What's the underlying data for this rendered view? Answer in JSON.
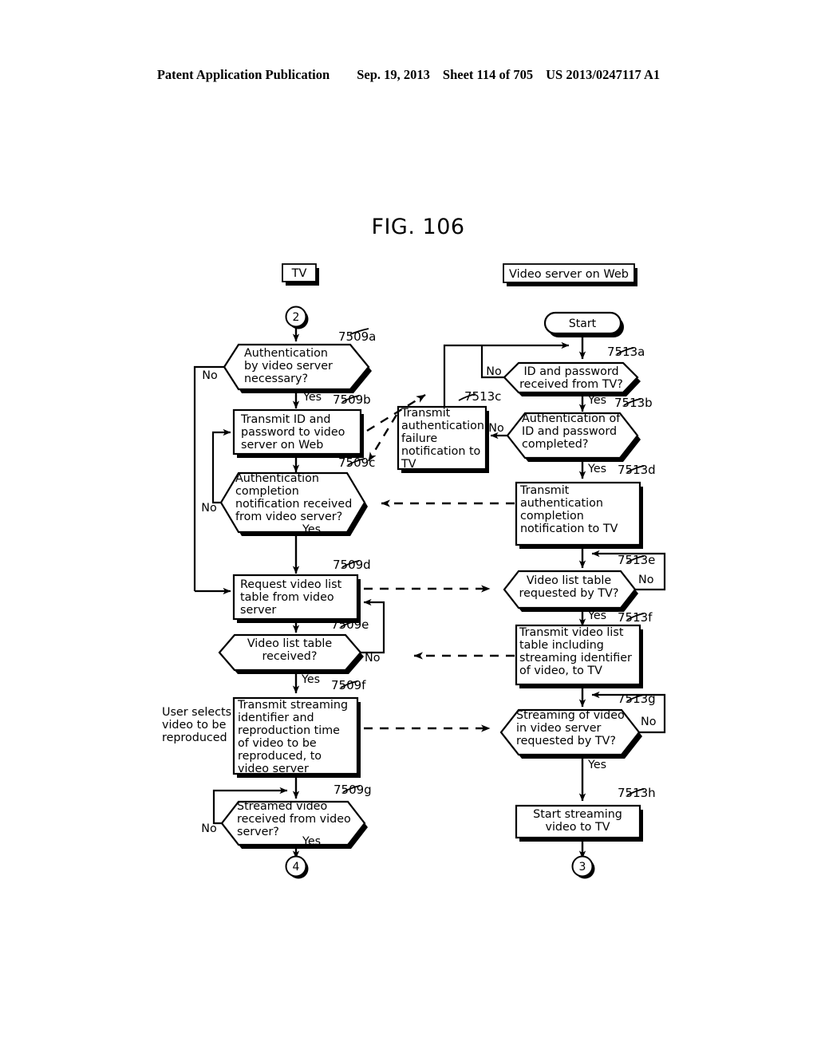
{
  "publication_header": {
    "left": "Patent Application Publication",
    "date": "Sep. 19, 2013",
    "sheet": "Sheet 114 of 705",
    "number": "US 2013/0247117 A1"
  },
  "figure": {
    "title": "FIG. 106",
    "lane_labels": {
      "left": "TV",
      "right": "Video server on Web"
    },
    "connectors": {
      "in_left": "2",
      "out_left": "4",
      "out_right": "3",
      "start_right": "Start"
    },
    "side_note": "User selects video to be reproduced",
    "left_nodes": [
      {
        "id": "7509a",
        "shape": "decision",
        "text": "Authentication by video server necessary?",
        "lines": [
          "Authentication",
          "by video server",
          "necessary?"
        ],
        "yes": "Yes",
        "no": "No"
      },
      {
        "id": "7509b",
        "shape": "process",
        "text": "Transmit ID and password to video server on Web",
        "lines": [
          "Transmit ID and",
          "password to video",
          "server on Web"
        ]
      },
      {
        "id": "7509c",
        "shape": "decision",
        "text": "Authentication completion notification received from video server?",
        "lines": [
          "Authentication",
          "completion",
          "notification received",
          "from video server?"
        ],
        "yes": "Yes",
        "no": "No"
      },
      {
        "id": "7509d",
        "shape": "process",
        "text": "Request video list table from video server",
        "lines": [
          "Request video list",
          "table from video",
          "server"
        ]
      },
      {
        "id": "7509e",
        "shape": "decision",
        "text": "Video list table received?",
        "lines": [
          "Video list table",
          "received?"
        ],
        "yes": "Yes",
        "no": "No"
      },
      {
        "id": "7509f",
        "shape": "process",
        "text": "Transmit streaming identifier and reproduction time of video to be reproduced, to video server",
        "lines": [
          "Transmit streaming",
          "identifier and",
          "reproduction time",
          "of video to be",
          "reproduced, to",
          "video server"
        ]
      },
      {
        "id": "7509g",
        "shape": "decision",
        "text": "Streamed video received from video server?",
        "lines": [
          "Streamed video",
          "received from video",
          "server?"
        ],
        "yes": "Yes",
        "no": "No"
      }
    ],
    "middle_nodes": [
      {
        "id": "7513c",
        "shape": "process",
        "text": "Transmit authentication failure notification to TV",
        "lines": [
          "Transmit",
          "authentication",
          "failure",
          "notification to",
          "TV"
        ]
      }
    ],
    "right_nodes": [
      {
        "id": "7513a",
        "shape": "decision",
        "text": "ID and password received from TV?",
        "lines": [
          "ID and password",
          "received from TV?"
        ],
        "yes": "Yes",
        "no": "No"
      },
      {
        "id": "7513b",
        "shape": "decision",
        "text": "Authentication of ID and password completed?",
        "lines": [
          "Authentication of",
          "ID and password",
          "completed?"
        ],
        "yes": "Yes",
        "no": "No"
      },
      {
        "id": "7513d",
        "shape": "process",
        "text": "Transmit authentication completion notification to TV",
        "lines": [
          "Transmit",
          "authentication",
          "completion",
          "notification to TV"
        ]
      },
      {
        "id": "7513e",
        "shape": "decision",
        "text": "Video list table requested by TV?",
        "lines": [
          "Video list table",
          "requested by TV?"
        ],
        "yes": "Yes",
        "no": "No"
      },
      {
        "id": "7513f",
        "shape": "process",
        "text": "Transmit video list table including streaming identifier of video, to TV",
        "lines": [
          "Transmit video list",
          "table including",
          "streaming identifier",
          "of video, to TV"
        ]
      },
      {
        "id": "7513g",
        "shape": "decision",
        "text": "Streaming of video in video server requested by TV?",
        "lines": [
          "Streaming of video",
          "in video server",
          "requested by TV?"
        ],
        "yes": "Yes",
        "no": "No"
      },
      {
        "id": "7513h",
        "shape": "process",
        "text": "Start streaming video to TV",
        "lines": [
          "Start streaming",
          "video to TV"
        ]
      }
    ],
    "colors": {
      "ink": "#000000",
      "paper": "#ffffff"
    }
  }
}
